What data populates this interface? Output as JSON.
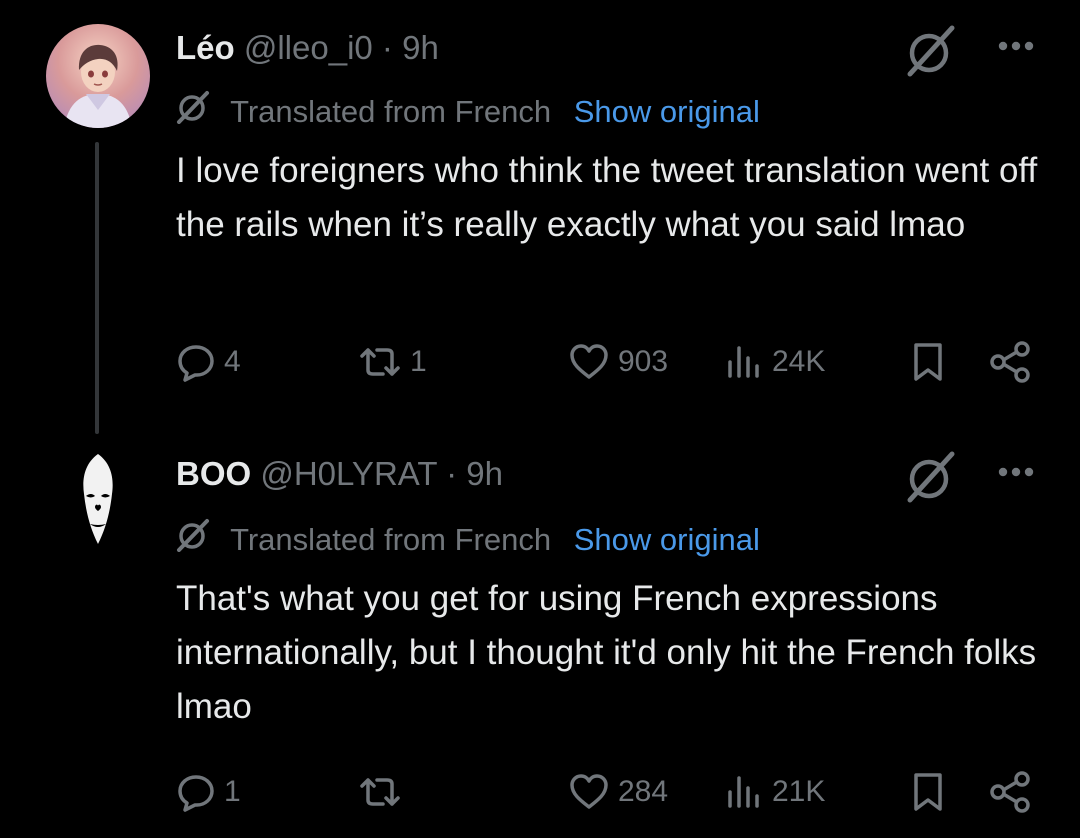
{
  "tweets": [
    {
      "name": "Léo",
      "handle": "@lleo_i0",
      "separator": "·",
      "time": "9h",
      "translated_label": "Translated from French",
      "show_original": "Show original",
      "text": "I love foreigners who think the tweet translation went off the rails when it’s really exactly what you said lmao",
      "replies": "4",
      "reposts": "1",
      "likes": "903",
      "views": "24K",
      "icons": {
        "avatar": "anime-boy-avatar",
        "grok": "grok-icon",
        "more": "more-icon",
        "reply": "reply-icon",
        "repost": "repost-icon",
        "like": "heart-icon",
        "views": "views-icon",
        "bookmark": "bookmark-icon",
        "share": "share-icon"
      }
    },
    {
      "name": "BOO",
      "handle": "@H0LYRAT",
      "separator": "·",
      "time": "9h",
      "translated_label": "Translated from French",
      "show_original": "Show original",
      "text": "That's what you get for using French expressions internationally, but I thought it'd only hit the French folks lmao",
      "replies": "1",
      "reposts": "",
      "likes": "284",
      "views": "21K",
      "icons": {
        "avatar": "mask-face-avatar",
        "grok": "grok-icon",
        "more": "more-icon",
        "reply": "reply-icon",
        "repost": "repost-icon",
        "like": "heart-icon",
        "views": "views-icon",
        "bookmark": "bookmark-icon",
        "share": "share-icon"
      }
    }
  ],
  "colors": {
    "background": "#000000",
    "primary_text": "#e7e9ea",
    "secondary_text": "#71767b",
    "link": "#4a99e9",
    "thread_line": "#333639"
  }
}
